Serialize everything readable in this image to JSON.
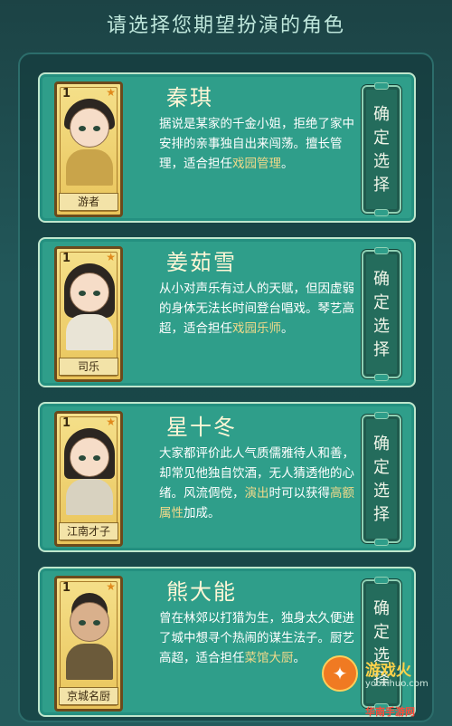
{
  "title": "请选择您期望扮演的角色",
  "select_label": [
    "确",
    "定",
    "选",
    "择"
  ],
  "characters": [
    {
      "rank": "1",
      "name": "秦琪",
      "role": "游者",
      "desc_plain": "据说是某家的千金小姐，拒绝了家中安排的亲事独自出来闯荡。擅长管理，适合担任",
      "desc_highlight": "戏园管理",
      "desc_tail": "。"
    },
    {
      "rank": "1",
      "name": "姜茹雪",
      "role": "司乐",
      "desc_plain": "从小对声乐有过人的天赋，但因虚弱的身体无法长时间登台唱戏。琴艺高超，适合担任",
      "desc_highlight": "戏园乐师",
      "desc_tail": "。"
    },
    {
      "rank": "1",
      "name": "星十冬",
      "role": "江南才子",
      "desc_plain": "大家都评价此人气质儒雅待人和善，却常见他独自饮酒，无人猜透他的心绪。风流倜傥，",
      "desc_highlight": "演出",
      "desc_mid": "时可以获得",
      "desc_highlight2": "高额属性",
      "desc_tail": "加成。"
    },
    {
      "rank": "1",
      "name": "熊大能",
      "role": "京城名厨",
      "desc_plain": "曾在林郊以打猎为生，独身太久便进了城中想寻个热闹的谋生法子。厨艺高超，适合担任",
      "desc_highlight": "菜馆大厨",
      "desc_tail": "。"
    }
  ],
  "watermark": {
    "main": "游戏火",
    "sub": "yooxihuo.com",
    "bottom": "华南手游网"
  }
}
